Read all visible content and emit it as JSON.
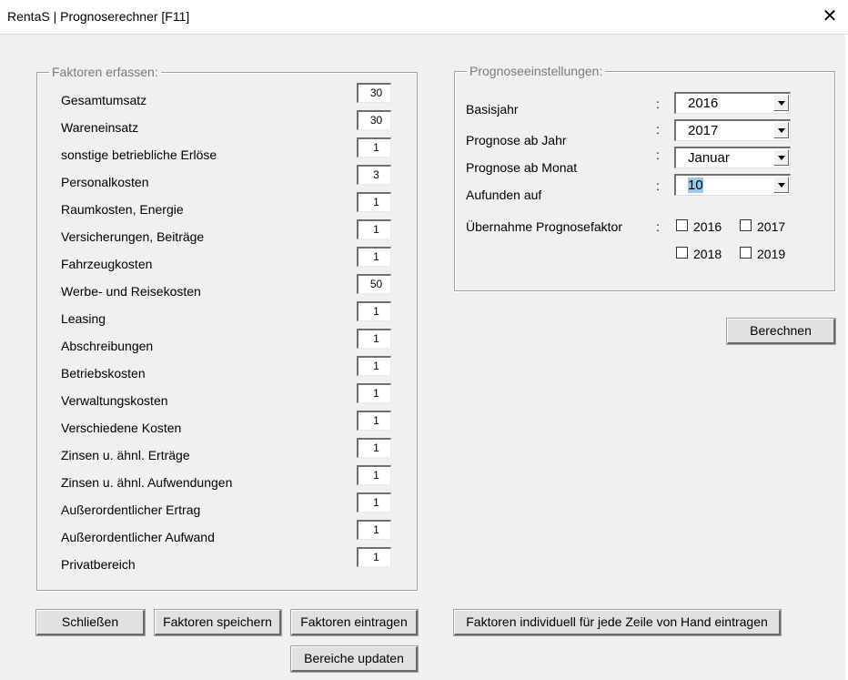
{
  "window": {
    "title": "RentaS | Prognoserechner [F11]",
    "close_glyph": "✕"
  },
  "factors": {
    "legend": "Faktoren erfassen:",
    "rows": [
      {
        "label": "Gesamtumsatz",
        "value": "30"
      },
      {
        "label": "Wareneinsatz",
        "value": "30"
      },
      {
        "label": "sonstige betriebliche Erlöse",
        "value": "1"
      },
      {
        "label": "Personalkosten",
        "value": "3"
      },
      {
        "label": "Raumkosten,  Energie",
        "value": "1"
      },
      {
        "label": "Versicherungen, Beiträge",
        "value": "1"
      },
      {
        "label": "Fahrzeugkosten",
        "value": "1"
      },
      {
        "label": "Werbe- und Reisekosten",
        "value": "50"
      },
      {
        "label": "Leasing",
        "value": "1"
      },
      {
        "label": "Abschreibungen",
        "value": "1"
      },
      {
        "label": "Betriebskosten",
        "value": "1"
      },
      {
        "label": "Verwaltungskosten",
        "value": "1"
      },
      {
        "label": "Verschiedene Kosten",
        "value": "1"
      },
      {
        "label": "Zinsen u. ähnl. Erträge",
        "value": "1"
      },
      {
        "label": "Zinsen u. ähnl. Aufwendungen",
        "value": "1"
      },
      {
        "label": "Außerordentlicher Ertrag",
        "value": "1"
      },
      {
        "label": "Außerordentlicher Aufwand",
        "value": "1"
      },
      {
        "label": "Privatbereich",
        "value": "1"
      }
    ]
  },
  "settings": {
    "legend": "Prognoseeinstellungen:",
    "colon": ":",
    "basisjahr": {
      "label": "Basisjahr",
      "value": "2016"
    },
    "prognose_jahr": {
      "label": "Prognose ab Jahr",
      "value": "2017"
    },
    "prognose_monat": {
      "label": "Prognose ab Monat",
      "value": "Januar"
    },
    "aufunden": {
      "label": "Aufunden auf",
      "value": "10"
    },
    "uebernahme": {
      "label": "Übernahme Prognosefaktor",
      "years": [
        {
          "label": "2016",
          "checked": false
        },
        {
          "label": "2017",
          "checked": false
        },
        {
          "label": "2018",
          "checked": false
        },
        {
          "label": "2019",
          "checked": false
        }
      ]
    }
  },
  "buttons": {
    "berechnen": "Berechnen",
    "schliessen": "Schließen",
    "faktoren_speichern": "Faktoren speichern",
    "faktoren_eintragen": "Faktoren eintragen",
    "individuell": "Faktoren individuell für jede Zeile von Hand eintragen",
    "bereiche_updaten": "Bereiche updaten"
  }
}
